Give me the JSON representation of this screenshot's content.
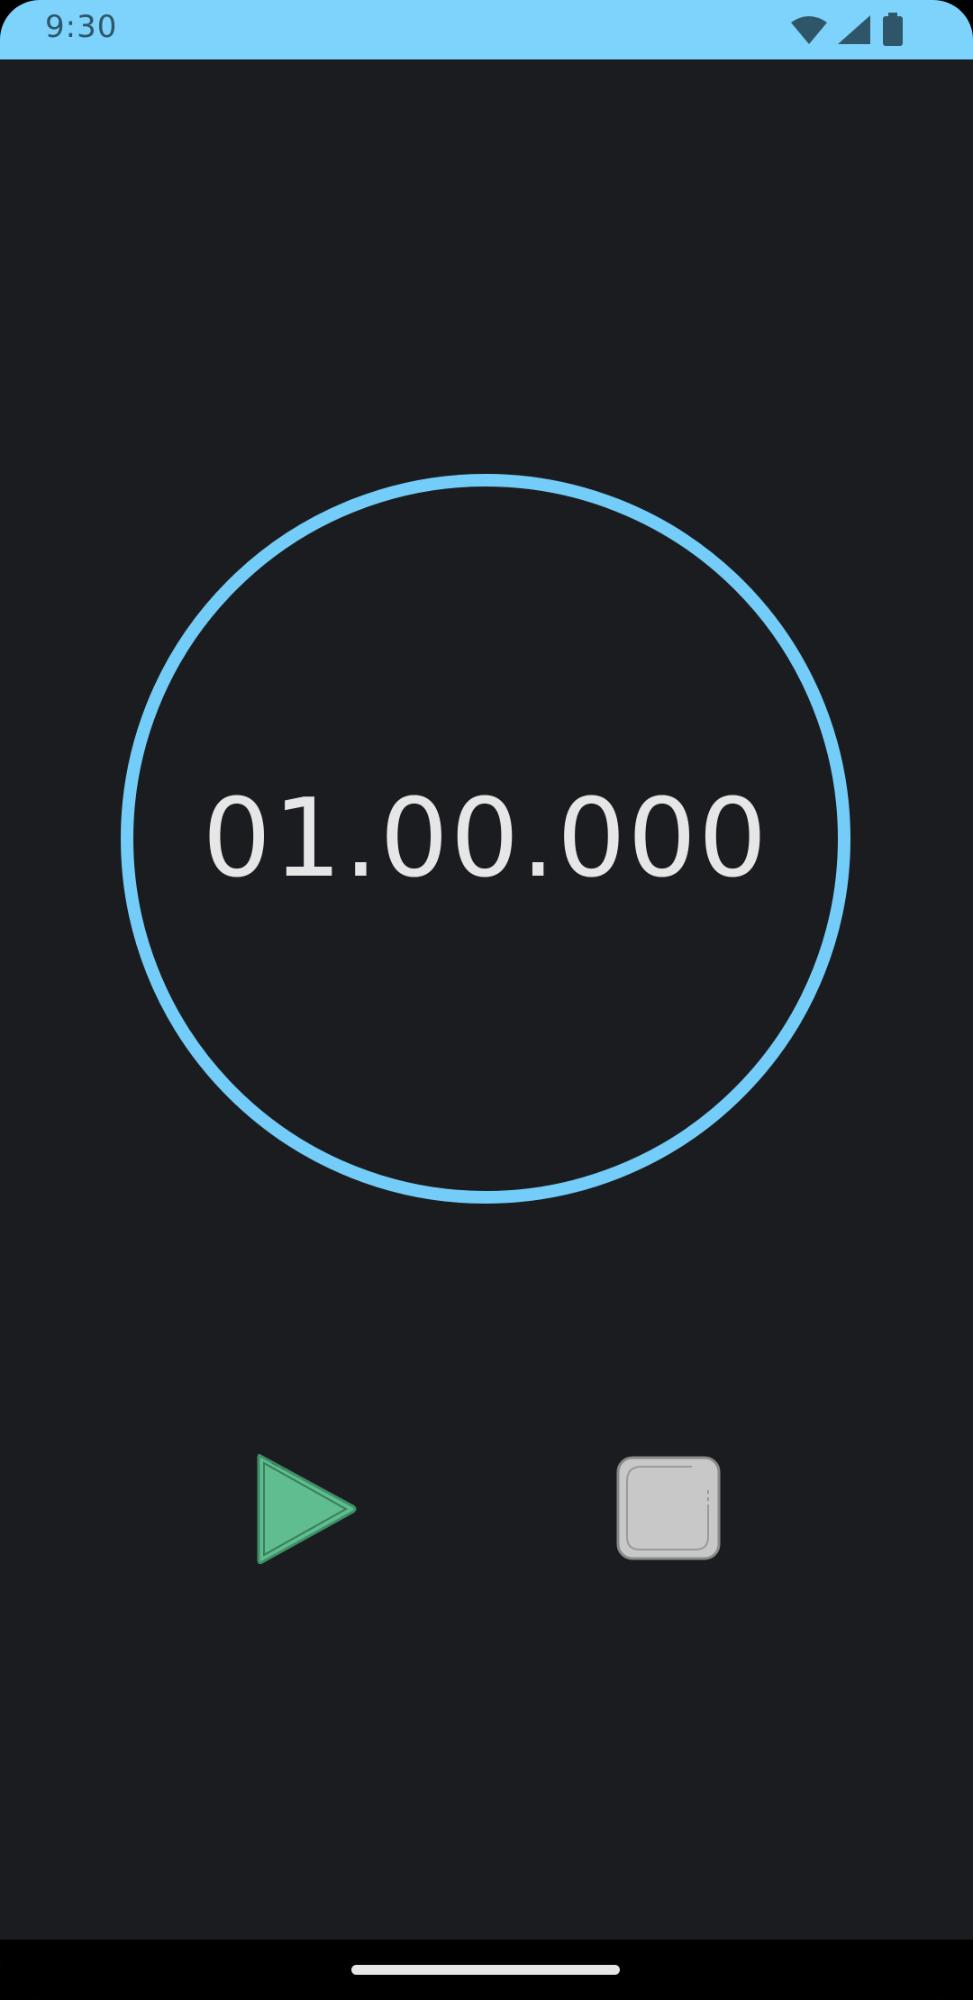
{
  "status_bar": {
    "time": "9:30",
    "background_color": "#7dd3fc",
    "icons": [
      "wifi-icon",
      "cellular-signal-icon",
      "battery-icon"
    ]
  },
  "timer": {
    "display": "01.00.000",
    "ring_color": "#74cdf8"
  },
  "controls": {
    "play_icon": "play-icon",
    "play_color": "#5fbd8f",
    "stop_icon": "stop-icon",
    "stop_color": "#c8c8c8"
  },
  "nav_bar": {
    "handle": "home-handle"
  },
  "theme": {
    "background": "#1a1c1f"
  }
}
